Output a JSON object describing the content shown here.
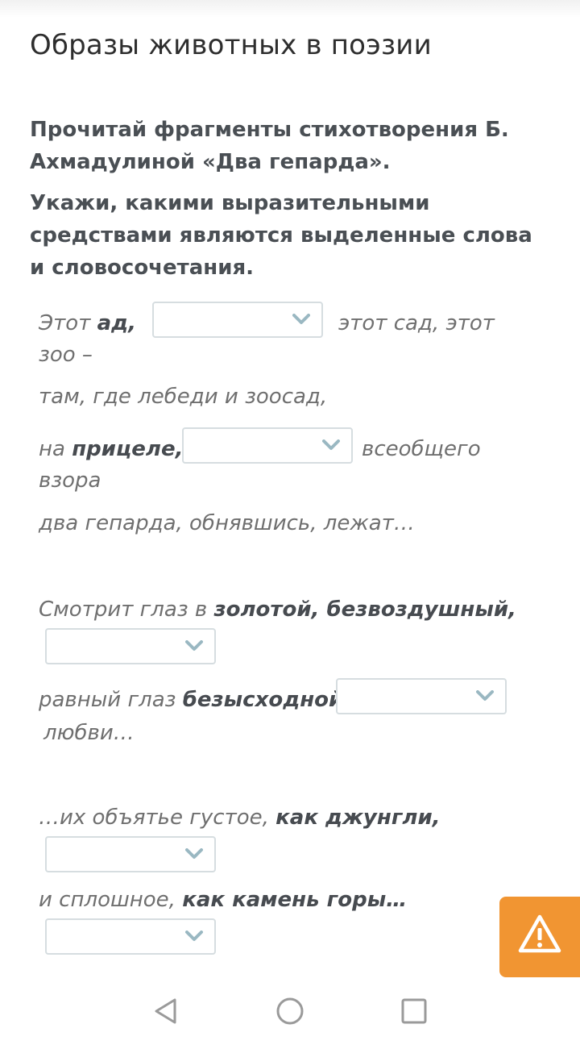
{
  "page": {
    "title": "Образы животных в поэзии",
    "instruction_1": "Прочитай фрагменты стихотворения Б. Ахмадулиной «Два гепарда».",
    "instruction_2": "Укажи, какими выразительными средствами являются выделенные слова и словосочетания."
  },
  "lines": {
    "l1_a": "Этот ",
    "l1_b": "ад,",
    "l1_c": "этот сад, этот",
    "l1_d": "зоо –",
    "l2": "там, где лебеди и зоосад,",
    "l3_a": "на ",
    "l3_b": "прицеле,",
    "l3_c": "всеобщего",
    "l3_d": "взора",
    "l4": "два гепарда, обнявшись, лежат…",
    "l5_a": "Смотрит глаз в ",
    "l5_b": "золотой, безвоздушный,",
    "l6_a": "равный глаз ",
    "l6_b": "безысходной",
    "l6_c": "любви…",
    "l7_a": "…их объятье густое, ",
    "l7_b": "как джунгли,",
    "l8_a": "и сплошное, ",
    "l8_b": "как камень горы…"
  },
  "dropdowns": {
    "d1": "",
    "d2": "",
    "d3": "",
    "d4": "",
    "d5": "",
    "d6": ""
  },
  "icons": {
    "dropdown": "chevron-down-icon",
    "report": "warning-icon",
    "nav_back": "triangle-back-icon",
    "nav_home": "circle-home-icon",
    "nav_recent": "square-recent-icon"
  },
  "colors": {
    "accent": "#f19532",
    "chevron": "#9ab8c2",
    "border": "#d6dde0"
  }
}
